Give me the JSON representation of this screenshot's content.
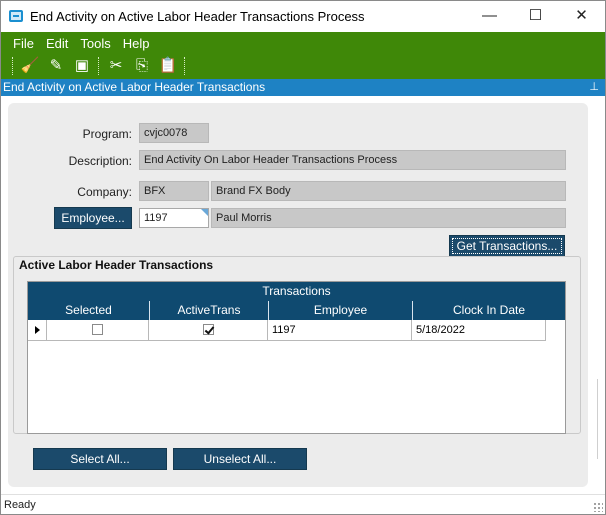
{
  "window": {
    "title": "End Activity on Active Labor Header Transactions Process",
    "minimize_glyph": "—",
    "maximize_glyph": "☐",
    "close_glyph": "✕"
  },
  "menu": {
    "items": [
      "File",
      "Edit",
      "Tools",
      "Help"
    ]
  },
  "toolbar": {
    "icons": [
      "clear-icon",
      "new-icon",
      "save-icon",
      "cut-icon",
      "copy-icon",
      "paste-icon"
    ],
    "glyphs": [
      "🧹",
      "✎",
      "▣",
      "✂",
      "⎘",
      "📋"
    ]
  },
  "panel": {
    "header": "End Activity on Active Labor Header Transactions",
    "pin_glyph": "⊥"
  },
  "form": {
    "program_label": "Program:",
    "program_value": "cvjc0078",
    "description_label": "Description:",
    "description_value": "End Activity On Labor Header Transactions Process",
    "company_label": "Company:",
    "company_code": "BFX",
    "company_name": "Brand FX Body",
    "employee_button": "Employee...",
    "employee_id": "1197",
    "employee_name": "Paul Morris",
    "get_transactions_button": "Get Transactions..."
  },
  "group": {
    "title": "Active Labor Header Transactions"
  },
  "grid": {
    "caption": "Transactions",
    "columns": [
      "Selected",
      "ActiveTrans",
      "Employee",
      "Clock In Date"
    ],
    "rows": [
      {
        "selected": false,
        "active_trans": true,
        "employee": "1197",
        "clock_in_date": "5/18/2022"
      }
    ]
  },
  "actions": {
    "select_all": "Select All...",
    "unselect_all": "Unselect All..."
  },
  "status": {
    "text": "Ready"
  },
  "colors": {
    "toolbar_green": "#3f8808",
    "panel_header_blue": "#1e82c4",
    "grid_header_navy": "#0f4a70",
    "button_navy": "#1b4a6b"
  }
}
